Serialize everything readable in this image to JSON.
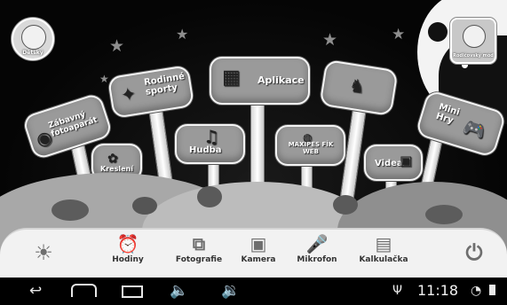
{
  "profiles": {
    "child_label": "Dětský",
    "parent_label": "Rodičovský mód"
  },
  "signs": {
    "foto_label": "Zábavný fotoaparát",
    "sport_label": "Rodinné sporty",
    "aplikace_label": "Aplikace",
    "hudba_label": "Hudba",
    "web_label": "MAXIPES FÍK WEB",
    "kresleni_label": "Kreslení",
    "videa_label": "Videa",
    "hry_label": "Mini Hry"
  },
  "dock": {
    "hodiny": "Hodiny",
    "fotografie": "Fotografie",
    "kamera": "Kamera",
    "mikrofon": "Mikrofon",
    "kalkulacka": "Kalkulačka"
  },
  "status": {
    "time": "11:18"
  },
  "icons": [
    "back-icon",
    "home-icon",
    "recent-apps-icon",
    "volume-down-icon",
    "volume-up-icon",
    "usb-icon",
    "wifi-icon",
    "battery-icon",
    "brightness-icon",
    "power-icon",
    "alarm-clock-icon",
    "photos-icon",
    "camera-icon",
    "microphone-icon",
    "calculator-icon"
  ]
}
